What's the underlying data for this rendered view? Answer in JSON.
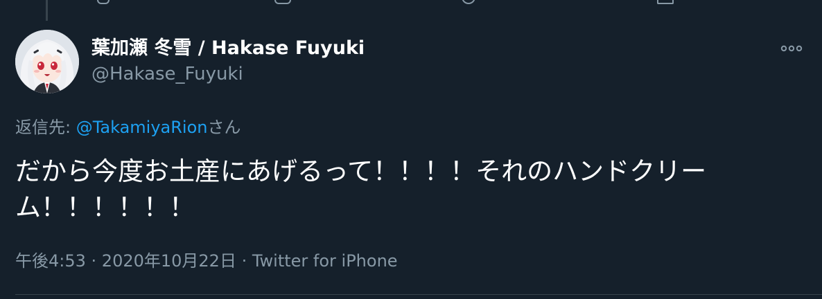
{
  "tweet": {
    "author": {
      "display_name": "葉加瀬 冬雪 / Hakase Fuyuki",
      "handle": "@Hakase_Fuyuki"
    },
    "reply_to": {
      "prefix": "返信先: ",
      "mention": "@TakamiyaRion",
      "suffix": "さん"
    },
    "text": "だから今度お土産にあげるって！！！！それのハンドクリーム！！！！！！",
    "time": "午後4:53",
    "separator": " · ",
    "date": "2020年10月22日",
    "source": "Twitter for iPhone"
  },
  "icons": {
    "more": "more-horizontal-icon",
    "avatar": "anime-girl-avatar"
  },
  "colors": {
    "background": "#15202b",
    "text_primary": "#ffffff",
    "text_secondary": "#8899a6",
    "link": "#1da1f2",
    "border": "#38444d"
  }
}
